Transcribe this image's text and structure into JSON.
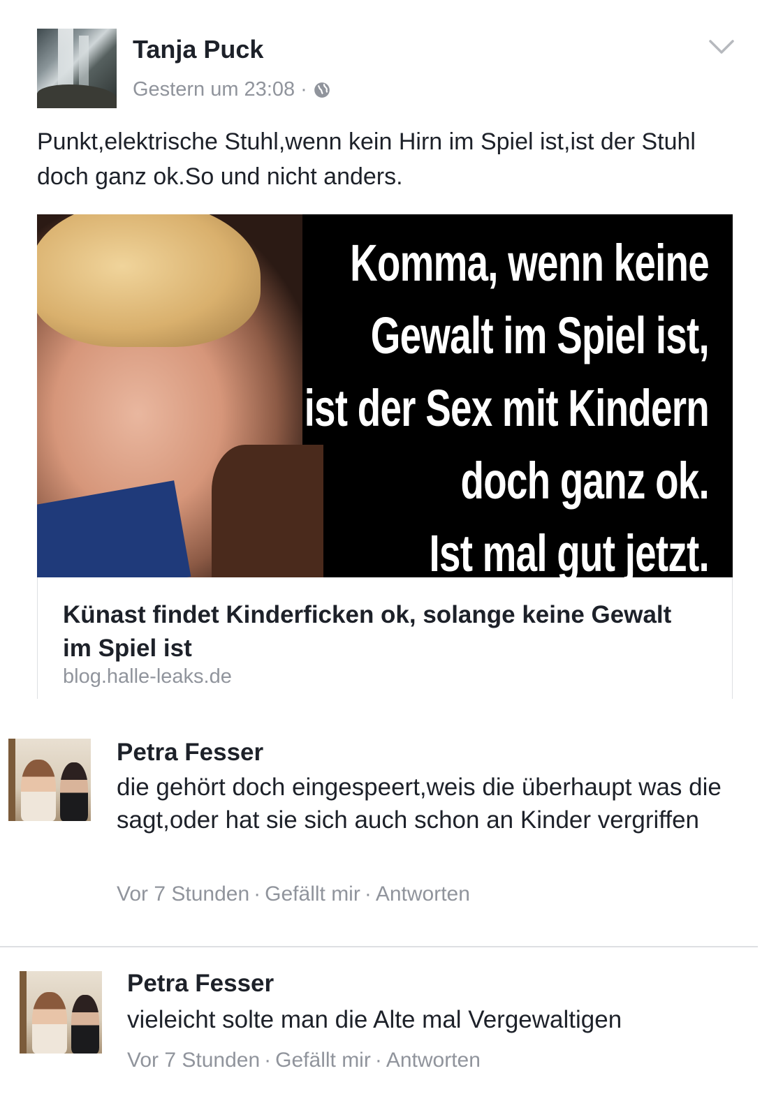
{
  "post": {
    "author": "Tanja Puck",
    "timestamp": "Gestern um 23:08",
    "separator": "·",
    "privacy_icon": "globe-icon",
    "menu_icon": "chevron-down-icon",
    "text": "Punkt,elektrische Stuhl,wenn kein Hirn im Spiel ist,ist der Stuhl doch ganz ok.So und nicht anders."
  },
  "shared_image": {
    "lines": [
      "Komma, wenn keine",
      "Gewalt im Spiel ist,",
      "ist der Sex mit Kindern",
      "doch ganz ok.",
      "Ist mal gut jetzt."
    ]
  },
  "link_preview": {
    "title": "Künast findet Kinderficken ok, solange keine Gewalt im Spiel ist",
    "domain": "blog.halle-leaks.de"
  },
  "comments": [
    {
      "author": "Petra Fesser",
      "text": "die gehört doch eingespeert,weis die überhaupt was die sagt,oder hat sie sich auch schon an Kinder vergriffen",
      "time": "Vor 7 Stunden",
      "like_label": "Gefällt mir",
      "reply_label": "Antworten"
    },
    {
      "author": "Petra Fesser",
      "text": "vieleicht solte man die Alte mal Vergewaltigen",
      "time": "Vor 7 Stunden",
      "like_label": "Gefällt mir",
      "reply_label": "Antworten"
    }
  ],
  "colors": {
    "text": "#1d2129",
    "secondary": "#90949c",
    "divider": "#dddfe2"
  }
}
